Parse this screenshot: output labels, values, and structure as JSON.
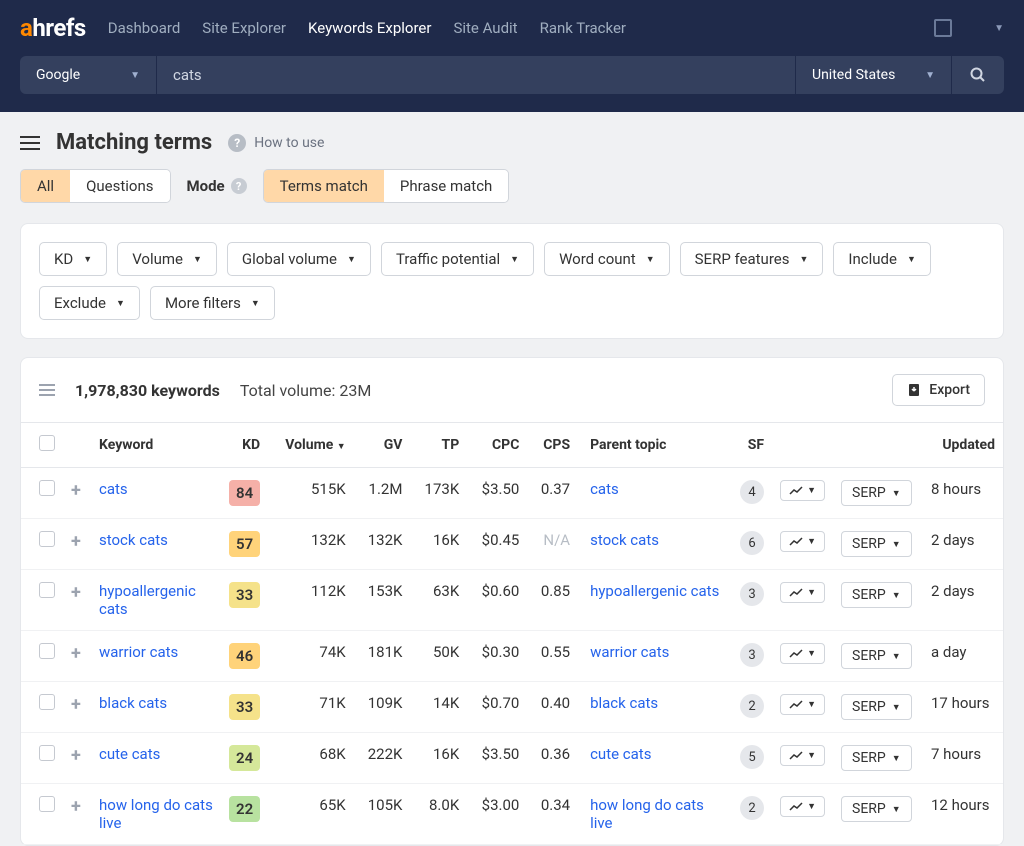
{
  "nav": {
    "logo_a": "a",
    "logo_rest": "hrefs",
    "items": [
      {
        "label": "Dashboard",
        "active": false
      },
      {
        "label": "Site Explorer",
        "active": false
      },
      {
        "label": "Keywords Explorer",
        "active": true
      },
      {
        "label": "Site Audit",
        "active": false
      },
      {
        "label": "Rank Tracker",
        "active": false
      }
    ]
  },
  "search": {
    "engine": "Google",
    "query": "cats",
    "country": "United States"
  },
  "page": {
    "title": "Matching terms",
    "how_to_use": "How to use"
  },
  "view_toggle": {
    "all": "All",
    "questions": "Questions"
  },
  "mode": {
    "label": "Mode",
    "terms": "Terms match",
    "phrase": "Phrase match"
  },
  "filters": [
    "KD",
    "Volume",
    "Global volume",
    "Traffic potential",
    "Word count",
    "SERP features",
    "Include",
    "Exclude",
    "More filters"
  ],
  "results": {
    "count": "1,978,830 keywords",
    "total_volume": "Total volume: 23M",
    "export": "Export"
  },
  "columns": {
    "keyword": "Keyword",
    "kd": "KD",
    "volume": "Volume",
    "gv": "GV",
    "tp": "TP",
    "cpc": "CPC",
    "cps": "CPS",
    "parent": "Parent topic",
    "sf": "SF",
    "updated": "Updated",
    "serp": "SERP"
  },
  "rows": [
    {
      "keyword": "cats",
      "kd": "84",
      "kd_class": "kd-red",
      "volume": "515K",
      "gv": "1.2M",
      "tp": "173K",
      "cpc": "$3.50",
      "cps": "0.37",
      "parent": "cats",
      "sf": "4",
      "updated": "8 hours"
    },
    {
      "keyword": "stock cats",
      "kd": "57",
      "kd_class": "kd-orange",
      "volume": "132K",
      "gv": "132K",
      "tp": "16K",
      "cpc": "$0.45",
      "cps": "N/A",
      "parent": "stock cats",
      "sf": "6",
      "updated": "2 days"
    },
    {
      "keyword": "hypoallergenic cats",
      "kd": "33",
      "kd_class": "kd-yellow",
      "volume": "112K",
      "gv": "153K",
      "tp": "63K",
      "cpc": "$0.60",
      "cps": "0.85",
      "parent": "hypoallergenic cats",
      "sf": "3",
      "updated": "2 days"
    },
    {
      "keyword": "warrior cats",
      "kd": "46",
      "kd_class": "kd-orange",
      "volume": "74K",
      "gv": "181K",
      "tp": "50K",
      "cpc": "$0.30",
      "cps": "0.55",
      "parent": "warrior cats",
      "sf": "3",
      "updated": "a day"
    },
    {
      "keyword": "black cats",
      "kd": "33",
      "kd_class": "kd-yellow",
      "volume": "71K",
      "gv": "109K",
      "tp": "14K",
      "cpc": "$0.70",
      "cps": "0.40",
      "parent": "black cats",
      "sf": "2",
      "updated": "17 hours"
    },
    {
      "keyword": "cute cats",
      "kd": "24",
      "kd_class": "kd-lime",
      "volume": "68K",
      "gv": "222K",
      "tp": "16K",
      "cpc": "$3.50",
      "cps": "0.36",
      "parent": "cute cats",
      "sf": "5",
      "updated": "7 hours"
    },
    {
      "keyword": "how long do cats live",
      "kd": "22",
      "kd_class": "kd-green",
      "volume": "65K",
      "gv": "105K",
      "tp": "8.0K",
      "cpc": "$3.00",
      "cps": "0.34",
      "parent": "how long do cats live",
      "sf": "2",
      "updated": "12 hours"
    }
  ]
}
